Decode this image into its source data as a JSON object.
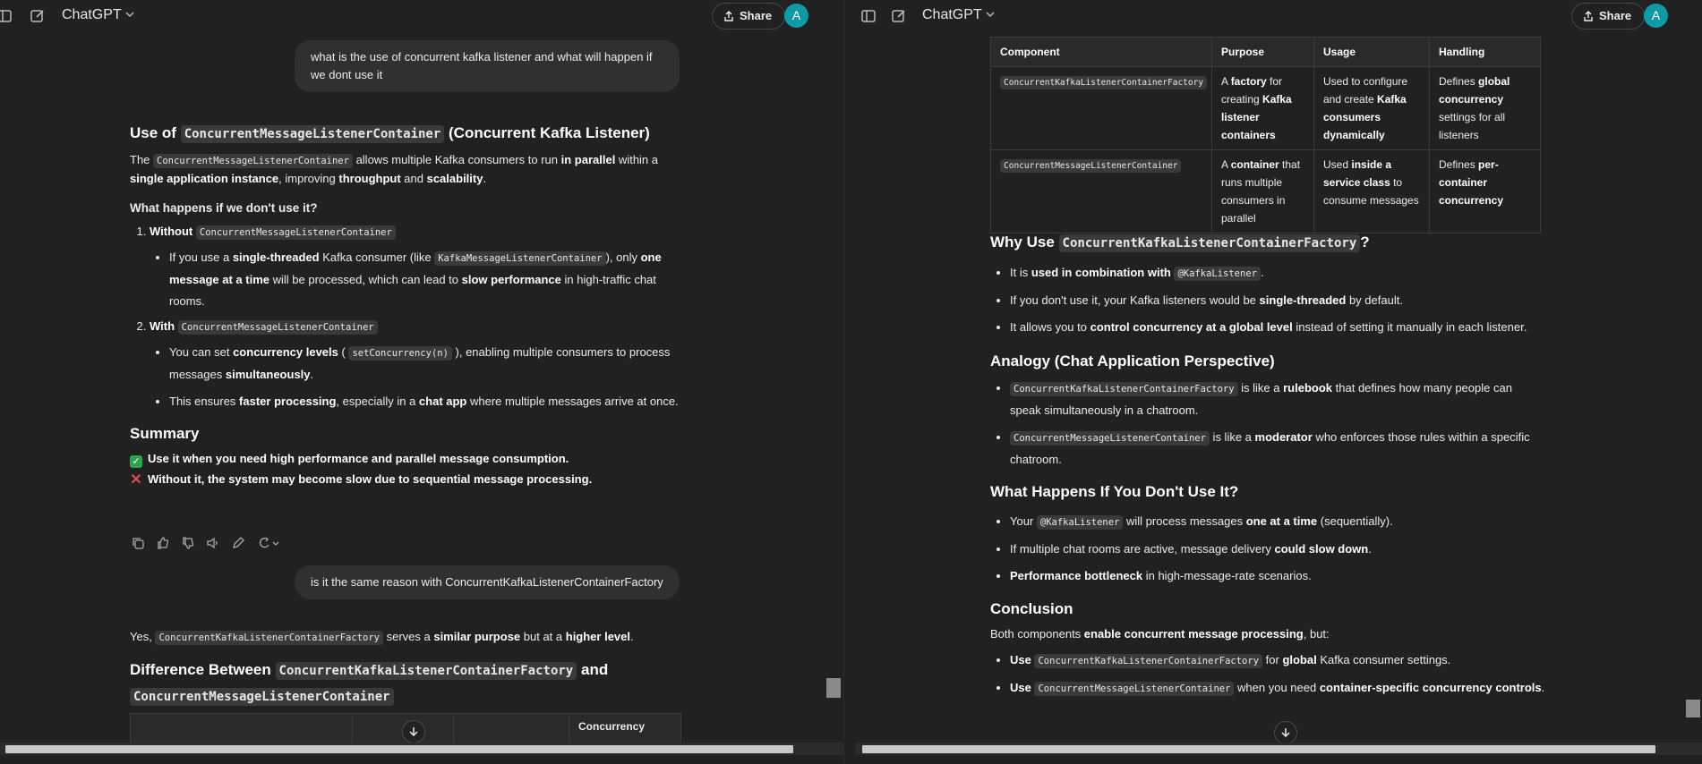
{
  "app": {
    "title": "ChatGPT",
    "share_label": "Share",
    "avatar_letter": "A"
  },
  "left": {
    "user_msg_1": "what is the use of concurrent kafka listener and what will happen if we dont use it",
    "h_use_prefix": "Use of",
    "h_use_code": "ConcurrentMessageListenerContainer",
    "h_use_suffix": "(Concurrent Kafka Listener)",
    "intro": {
      "code": "ConcurrentMessageListenerContainer",
      "t1": " allows multiple Kafka consumers to run ",
      "b1": "in parallel",
      "t2": " within a ",
      "b2": "single application instance",
      "t3": ", improving ",
      "b3": "throughput",
      "t4": " and ",
      "b4": "scalability",
      "t5": "."
    },
    "what_happens": "What happens if we don't use it?",
    "item1": {
      "label": "Without",
      "code": "ConcurrentMessageListenerContainer",
      "b1_t1": "If you use a ",
      "b1_b1": "single-threaded",
      "b1_t2": " Kafka consumer (like ",
      "b1_code": "KafkaMessageListenerContainer",
      "b1_t3": "), only ",
      "b1_b2": "one message at a time",
      "b1_t4": " will be processed, which can lead to ",
      "b1_b3": "slow performance",
      "b1_t5": " in high-traffic chat rooms."
    },
    "item2": {
      "label": "With",
      "code": "ConcurrentMessageListenerContainer",
      "b1_t1": "You can set ",
      "b1_b1": "concurrency levels",
      "b1_t2": " ( ",
      "b1_code": "setConcurrency(n)",
      "b1_t3": " ), enabling multiple consumers to process messages ",
      "b1_b2": "simultaneously",
      "b1_t4": ".",
      "b2_t1": "This ensures ",
      "b2_b1": "faster processing",
      "b2_t2": ", especially in a ",
      "b2_b2": "chat app",
      "b2_t3": " where multiple messages arrive at once."
    },
    "summary_heading": "Summary",
    "summary_1": "Use it when you need high performance and parallel message consumption.",
    "summary_2": "Without it, the system may become slow due to sequential message processing.",
    "user_msg_2": "is it the same reason with ConcurrentKafkaListenerContainerFactory",
    "answer2": {
      "t1": "Yes, ",
      "code": "ConcurrentKafkaListenerContainerFactory",
      "t2": " serves a ",
      "b1": "similar purpose",
      "t3": " but at a ",
      "b2": "higher level",
      "t4": "."
    },
    "diff_heading": {
      "prefix": "Difference Between",
      "code1": "ConcurrentKafkaListenerContainerFactory",
      "and": "and",
      "code2": "ConcurrentMessageListenerContainer"
    },
    "table_partial_header": "Concurrency"
  },
  "right": {
    "table": {
      "headers": [
        "Component",
        "Purpose",
        "Usage",
        "Handling"
      ],
      "rows": [
        {
          "component": "ConcurrentKafkaListenerContainerFactory",
          "p_t1": "A ",
          "p_b1": "factory",
          "p_t2": " for creating ",
          "p_b2": "Kafka listener containers",
          "u_t1": "Used to configure and create ",
          "u_b1": "Kafka consumers dynamically",
          "h_t1": "Defines ",
          "h_b1": "global concurrency",
          "h_t2": " settings for all listeners"
        },
        {
          "component": "ConcurrentMessageListenerContainer",
          "p_t1": "A ",
          "p_b1": "container",
          "p_t2": " that runs multiple consumers in parallel",
          "p_b2": "",
          "u_t1": "Used ",
          "u_b1": "inside a service class",
          "u_t2": " to consume messages",
          "h_t1": "Defines ",
          "h_b1": "per-container concurrency",
          "h_t2": ""
        }
      ]
    },
    "why_heading": {
      "prefix": "Why Use",
      "code": "ConcurrentKafkaListenerContainerFactory",
      "suffix": "?"
    },
    "why_1": {
      "t1": "It is ",
      "b1": "used in combination with",
      "code": "@KafkaListener",
      "t2": "."
    },
    "why_2": {
      "t1": "If you don't use it, your Kafka listeners would be ",
      "b1": "single-threaded",
      "t2": " by default."
    },
    "why_3": {
      "t1": "It allows you to ",
      "b1": "control concurrency at a global level",
      "t2": " instead of setting it manually in each listener."
    },
    "analogy_heading": "Analogy (Chat Application Perspective)",
    "analogy_1": {
      "code": "ConcurrentKafkaListenerContainerFactory",
      "t1": " is like a ",
      "b1": "rulebook",
      "t2": " that defines how many people can speak simultaneously in a chatroom."
    },
    "analogy_2": {
      "code": "ConcurrentMessageListenerContainer",
      "t1": " is like a ",
      "b1": "moderator",
      "t2": " who enforces those rules within a specific chatroom."
    },
    "happens_heading": "What Happens If You Don't Use It?",
    "happens_1": {
      "t1": "Your ",
      "code": "@KafkaListener",
      "t2": " will process messages ",
      "b1": "one at a time",
      "t3": " (sequentially)."
    },
    "happens_2": {
      "t1": "If multiple chat rooms are active, message delivery ",
      "b1": "could slow down",
      "t2": "."
    },
    "happens_3": {
      "b1": "Performance bottleneck",
      "t1": " in high-message-rate scenarios."
    },
    "conclusion_heading": "Conclusion",
    "conclusion_intro": {
      "t1": "Both components ",
      "b1": "enable concurrent message processing",
      "t2": ", but:"
    },
    "conclusion_1": {
      "b1": "Use",
      "code": "ConcurrentKafkaListenerContainerFactory",
      "t1": " for ",
      "b2": "global",
      "t2": " Kafka consumer settings."
    },
    "conclusion_2": {
      "b1": "Use",
      "code": "ConcurrentMessageListenerContainer",
      "t1": " when you need ",
      "b2": "container-specific concurrency controls",
      "t2": "."
    }
  }
}
